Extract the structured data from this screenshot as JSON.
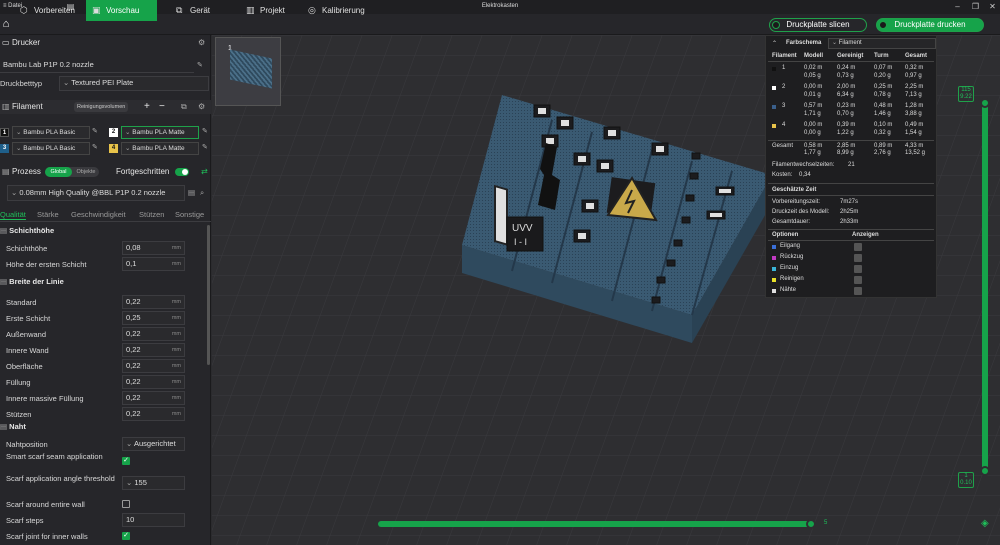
{
  "window": {
    "menu_label": "Datei",
    "title": "Elektrokasten"
  },
  "tabs": [
    {
      "label": "Vorbereiten",
      "icon": "cube-icon"
    },
    {
      "label": "Vorschau",
      "icon": "play-icon"
    },
    {
      "label": "Gerät",
      "icon": "device-icon"
    },
    {
      "label": "Projekt",
      "icon": "project-icon"
    },
    {
      "label": "Kalibrierung",
      "icon": "calibration-icon"
    }
  ],
  "actions": {
    "slice_label": "Druckplatte slicen",
    "print_label": "Druckplatte drucken"
  },
  "printer": {
    "section_label": "Drucker",
    "name": "Bambu Lab P1P 0.2 nozzle",
    "bed_label": "Druckbetttyp",
    "bed_value": "Textured PEI Plate"
  },
  "filament": {
    "section_label": "Filament",
    "purge_button": "Reinigungsvolumen",
    "slots": [
      {
        "num": "1",
        "name": "Bambu PLA Basic",
        "color": "#111111"
      },
      {
        "num": "2",
        "name": "Bambu PLA Matte",
        "color": "#ffffff"
      },
      {
        "num": "3",
        "name": "Bambu PLA Basic",
        "color": "#1f5f8a"
      },
      {
        "num": "4",
        "name": "Bambu PLA Matte",
        "color": "#e8c34a"
      }
    ]
  },
  "process": {
    "section_label": "Prozess",
    "toggle_global": "Global",
    "toggle_objects": "Objekte",
    "advanced_label": "Fortgeschritten",
    "profile": "0.08mm High Quality @BBL P1P 0.2 nozzle"
  },
  "subtabs": [
    "Qualität",
    "Stärke",
    "Geschwindigkeit",
    "Stützen",
    "Sonstige"
  ],
  "layer_height": {
    "heading": "Schichthöhe",
    "rows": [
      {
        "label": "Schichthöhe",
        "value": "0,08",
        "unit": "mm"
      },
      {
        "label": "Höhe der ersten Schicht",
        "value": "0,1",
        "unit": "mm"
      }
    ]
  },
  "line_width": {
    "heading": "Breite der Linie",
    "rows": [
      {
        "label": "Standard",
        "value": "0,22",
        "unit": "mm"
      },
      {
        "label": "Erste Schicht",
        "value": "0,25",
        "unit": "mm"
      },
      {
        "label": "Außenwand",
        "value": "0,22",
        "unit": "mm"
      },
      {
        "label": "Innere Wand",
        "value": "0,22",
        "unit": "mm"
      },
      {
        "label": "Oberfläche",
        "value": "0,22",
        "unit": "mm"
      },
      {
        "label": "Füllung",
        "value": "0,22",
        "unit": "mm"
      },
      {
        "label": "Innere massive Füllung",
        "value": "0,22",
        "unit": "mm"
      },
      {
        "label": "Stützen",
        "value": "0,22",
        "unit": "mm"
      }
    ]
  },
  "seam": {
    "heading": "Naht",
    "position_label": "Nahtposition",
    "position_value": "Ausgerichtet",
    "smart_scarf_label": "Smart scarf seam application",
    "scarf_angle_label": "Scarf application angle threshold",
    "scarf_angle_value": "155",
    "scarf_around_label": "Scarf around entire wall",
    "scarf_steps_label": "Scarf steps",
    "scarf_steps_value": "10",
    "scarf_inner_label": "Scarf joint for inner walls"
  },
  "plate": {
    "number": "1"
  },
  "model_text": {
    "uvv": "UVV",
    "roman": "I - I"
  },
  "stats": {
    "header_label": "Farbschema",
    "select_value": "Filament",
    "columns": [
      "Filament",
      "Modell",
      "Gereinigt",
      "Turm",
      "Gesamt"
    ],
    "rows": [
      {
        "num": "1",
        "color": "#111111",
        "modell": [
          "0,02 m",
          "0,05 g"
        ],
        "gereinigt": [
          "0,24 m",
          "0,73 g"
        ],
        "turm": [
          "0,07 m",
          "0,20 g"
        ],
        "gesamt": [
          "0,32 m",
          "0,97 g"
        ]
      },
      {
        "num": "2",
        "color": "#ffffff",
        "modell": [
          "0,00 m",
          "0,01 g"
        ],
        "gereinigt": [
          "2,00 m",
          "6,34 g"
        ],
        "turm": [
          "0,25 m",
          "0,78 g"
        ],
        "gesamt": [
          "2,25 m",
          "7,13 g"
        ]
      },
      {
        "num": "3",
        "color": "#3a5f8a",
        "modell": [
          "0,57 m",
          "1,71 g"
        ],
        "gereinigt": [
          "0,23 m",
          "0,70 g"
        ],
        "turm": [
          "0,48 m",
          "1,46 g"
        ],
        "gesamt": [
          "1,28 m",
          "3,88 g"
        ]
      },
      {
        "num": "4",
        "color": "#e8c34a",
        "modell": [
          "0,00 m",
          "0,00 g"
        ],
        "gereinigt": [
          "0,39 m",
          "1,22 g"
        ],
        "turm": [
          "0,10 m",
          "0,32 g"
        ],
        "gesamt": [
          "0,49 m",
          "1,54 g"
        ]
      }
    ],
    "total": {
      "label": "Gesamt",
      "modell": [
        "0,58 m",
        "1,77 g"
      ],
      "gereinigt": [
        "2,85 m",
        "8,99 g"
      ],
      "turm": [
        "0,89 m",
        "2,76 g"
      ],
      "gesamt": [
        "4,33 m",
        "13,52 g"
      ]
    },
    "filament_changes_label": "Filamentwechselzeiten:",
    "filament_changes_value": "21",
    "cost_label": "Kosten:",
    "cost_value": "0,34",
    "time_heading": "Geschätzte Zeit",
    "times": [
      {
        "label": "Vorbereitungszeit:",
        "value": "7m27s"
      },
      {
        "label": "Druckzeit des Modell:",
        "value": "2h25m"
      },
      {
        "label": "Gesamtdauer:",
        "value": "2h33m"
      }
    ],
    "options_label": "Optionen",
    "show_label": "Anzeigen",
    "options": [
      {
        "label": "Eilgang",
        "color": "#3a6fd8"
      },
      {
        "label": "Rückzug",
        "color": "#c23ac2"
      },
      {
        "label": "Einzug",
        "color": "#3ab4d8"
      },
      {
        "label": "Reinigen",
        "color": "#e8e02a"
      },
      {
        "label": "Nähte",
        "color": "#e0e0e0"
      }
    ]
  },
  "layer_slider": {
    "top_value": "115",
    "top_sub": "9.22",
    "bottom_value": "1",
    "bottom_sub": "0.10"
  },
  "move_slider": {
    "value": "5"
  }
}
